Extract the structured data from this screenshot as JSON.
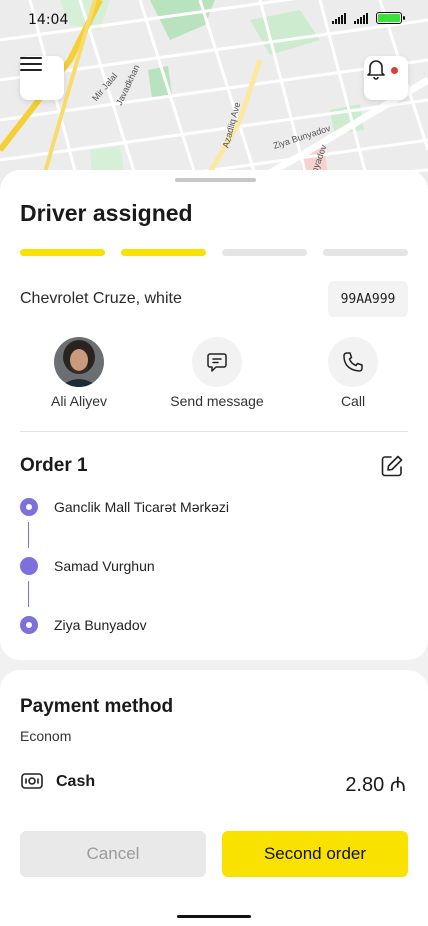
{
  "status_bar": {
    "time": "14:04",
    "battery_level": 1.0
  },
  "map": {
    "streets": [
      "Mir Jalal",
      "Javadkhan",
      "Azadliq Ave",
      "Ziya Bunyadov",
      "Ziya Bunyadov"
    ],
    "menu_icon": "hamburger-icon",
    "notification_icon": "bell-icon",
    "has_notification": true
  },
  "sheet": {
    "title": "Driver assigned",
    "progress": {
      "total_steps": 4,
      "completed_steps": 2
    },
    "car": "Chevrolet Cruze, white",
    "plate": "99AA999",
    "actions": [
      {
        "label": "Ali Aliyev",
        "icon": "avatar"
      },
      {
        "label": "Send message",
        "icon": "message-icon"
      },
      {
        "label": "Call",
        "icon": "phone-icon"
      }
    ],
    "order": {
      "title": "Order 1",
      "stops": [
        "Ganclik Mall Ticarət Mərkəzi",
        "Samad Vurghun",
        "Ziya Bunyadov"
      ]
    }
  },
  "payment": {
    "title": "Payment method",
    "tariff": "Econom",
    "method": "Cash",
    "amount": "2.80 ₼"
  },
  "buttons": {
    "cancel": "Cancel",
    "second_order": "Second order"
  },
  "colors": {
    "accent": "#f9e100",
    "route": "#7b70dc"
  }
}
